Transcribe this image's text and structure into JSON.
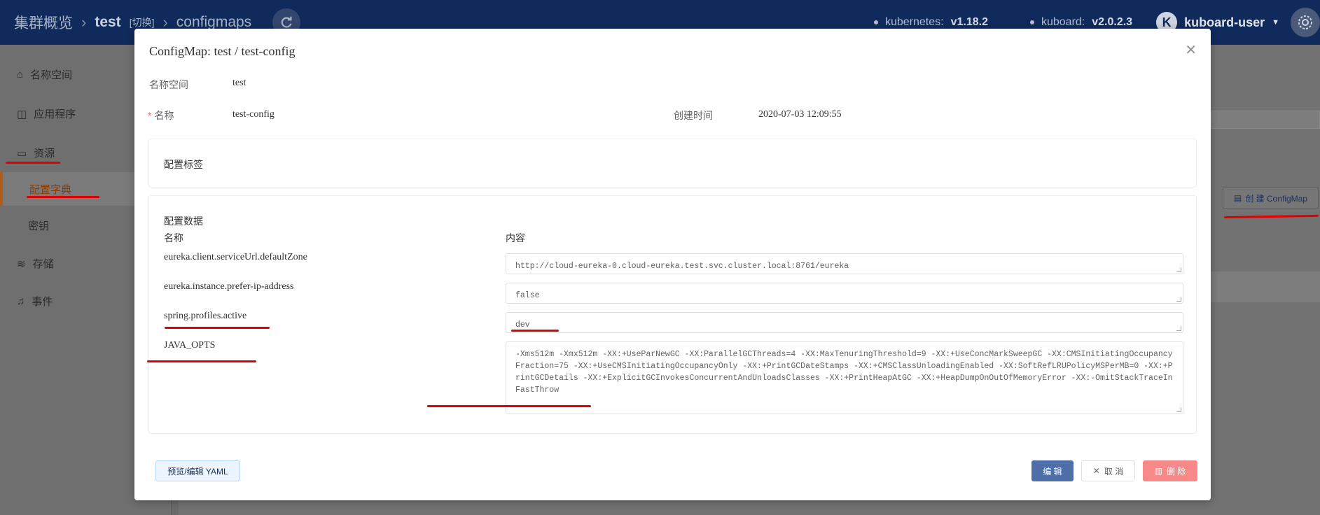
{
  "topbar": {
    "crumb1": "集群概览",
    "crumb2": "test",
    "crumb2_switch": "[切换]",
    "crumb3": "configmaps",
    "kubernetes_label": "kubernetes:",
    "kubernetes_version": "v1.18.2",
    "kuboard_label": "kuboard:",
    "kuboard_version": "v2.0.2.3",
    "avatar_letter": "K",
    "user": "kuboard-user"
  },
  "sidebar": {
    "items": [
      {
        "label": "名称空间",
        "icon": "home-icon"
      },
      {
        "label": "应用程序",
        "icon": "app-icon"
      },
      {
        "label": "资源",
        "icon": "resource-icon"
      },
      {
        "label": "配置字典"
      },
      {
        "label": "密钥"
      },
      {
        "label": "存储",
        "icon": "storage-icon"
      },
      {
        "label": "事件",
        "icon": "bell-icon"
      }
    ]
  },
  "background": {
    "create_button": "创 建 ConfigMap"
  },
  "modal": {
    "title": "ConfigMap: test / test-config",
    "namespace_label": "名称空间",
    "namespace_value": "test",
    "name_label": "名称",
    "name_required_mark": "*",
    "name_value": "test-config",
    "created_label": "创建时间",
    "created_value": "2020-07-03 12:09:55",
    "labels_section": "配置标签",
    "data_section": "配置数据",
    "col_name": "名称",
    "col_content": "内容",
    "entries": [
      {
        "key": "eureka.client.serviceUrl.defaultZone",
        "value": "http://cloud-eureka-0.cloud-eureka.test.svc.cluster.local:8761/eureka"
      },
      {
        "key": "eureka.instance.prefer-ip-address",
        "value": "false"
      },
      {
        "key": "spring.profiles.active",
        "value": "dev"
      },
      {
        "key": "JAVA_OPTS",
        "value": "-Xms512m -Xmx512m -XX:+UseParNewGC -XX:ParallelGCThreads=4 -XX:MaxTenuringThreshold=9 -XX:+UseConcMarkSweepGC -XX:CMSInitiatingOccupancyFraction=75 -XX:+UseCMSInitiatingOccupancyOnly -XX:+PrintGCDateStamps -XX:+CMSClassUnloadingEnabled -XX:SoftRefLRUPolicyMSPerMB=0 -XX:+PrintGCDetails  -XX:+ExplicitGCInvokesConcurrentAndUnloadsClasses -XX:+PrintHeapAtGC -XX:+HeapDumpOnOutOfMemoryError -XX:-OmitStackTraceInFastThrow"
      }
    ],
    "yaml_button": "预览/编辑 YAML",
    "edit_button": "编 辑",
    "cancel_button": "取 消",
    "delete_button": "删 除"
  },
  "colors": {
    "topbar": "#102a5c",
    "annotation": "#e00000",
    "primary": "#4e6fa8",
    "danger": "#f78989"
  }
}
